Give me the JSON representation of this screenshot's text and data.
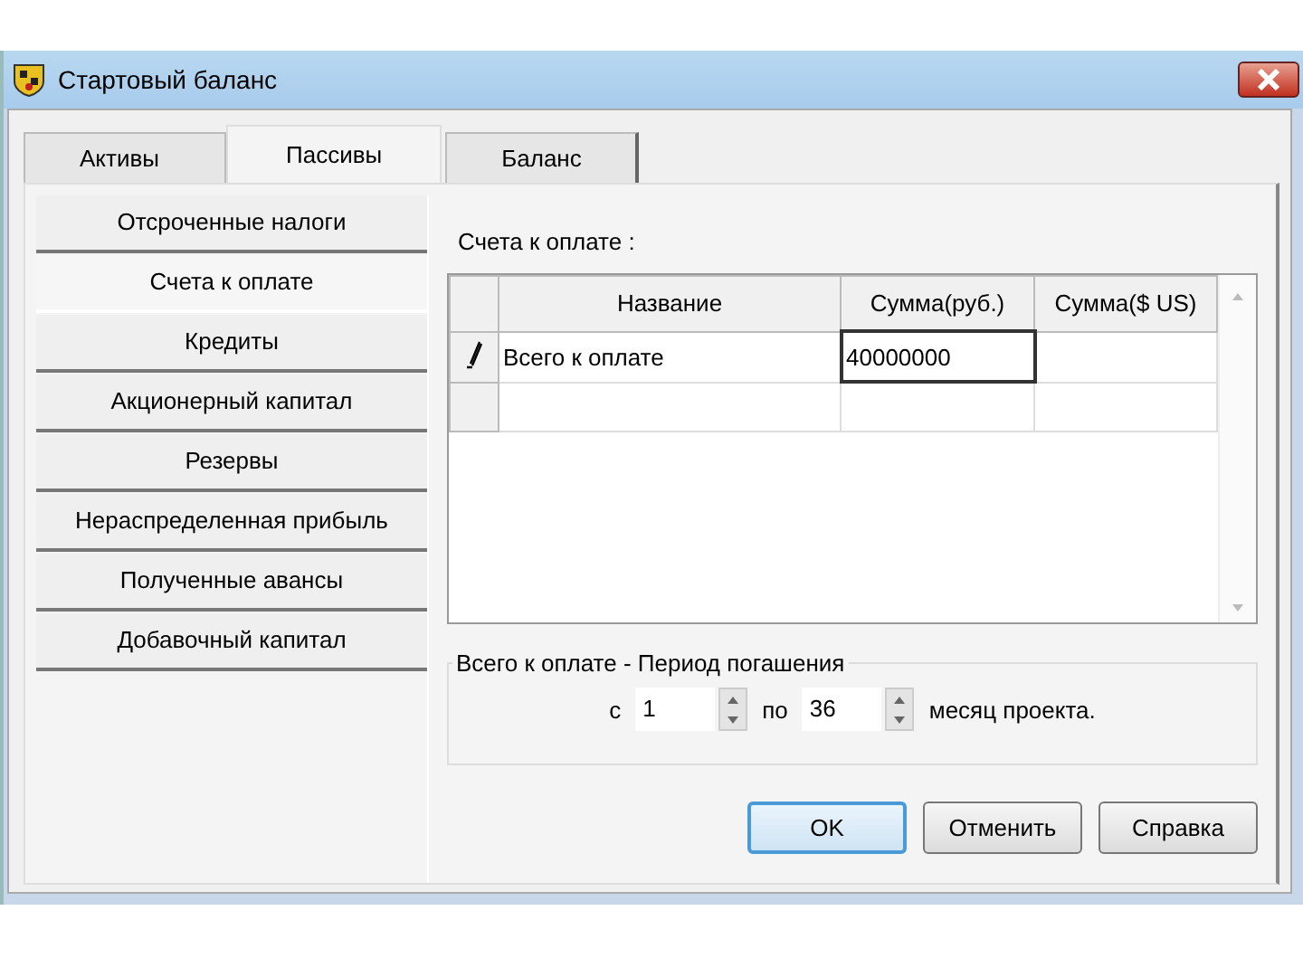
{
  "window": {
    "title": "Стартовый баланс"
  },
  "tabs": [
    {
      "label": "Активы",
      "selected": false
    },
    {
      "label": "Пассивы",
      "selected": true
    },
    {
      "label": "Баланс",
      "selected": false
    }
  ],
  "sidebar": {
    "items": [
      {
        "label": "Отсроченные налоги",
        "selected": false
      },
      {
        "label": "Счета к оплате",
        "selected": true
      },
      {
        "label": "Кредиты",
        "selected": false
      },
      {
        "label": "Акционерный капитал",
        "selected": false
      },
      {
        "label": "Резервы",
        "selected": false
      },
      {
        "label": "Нераспределенная прибыль",
        "selected": false
      },
      {
        "label": "Полученные авансы",
        "selected": false
      },
      {
        "label": "Добавочный капитал",
        "selected": false
      }
    ]
  },
  "section_title": "Счета к оплате :",
  "table": {
    "columns": [
      "Название",
      "Сумма(руб.)",
      "Сумма($ US)"
    ],
    "rows": [
      {
        "editing": true,
        "cells": [
          "Всего к оплате",
          "40000000",
          ""
        ]
      },
      {
        "editing": false,
        "cells": [
          "",
          "",
          ""
        ]
      }
    ]
  },
  "period": {
    "title": "Всего к оплате - Период погашения",
    "from_label": "с",
    "from_value": "1",
    "to_label": "по",
    "to_value": "36",
    "suffix": "месяц проекта."
  },
  "buttons": [
    {
      "label": "OK",
      "default": true
    },
    {
      "label": "Отменить",
      "default": false
    },
    {
      "label": "Справка",
      "default": false
    }
  ]
}
